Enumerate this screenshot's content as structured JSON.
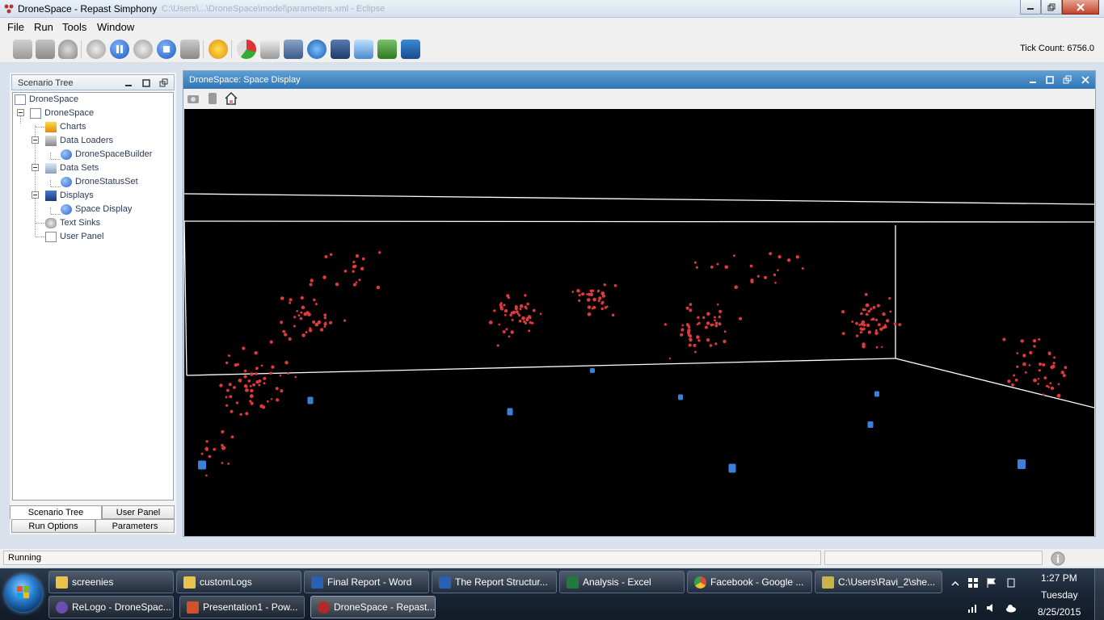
{
  "window": {
    "title": "DroneSpace - Repast Simphony",
    "ghost_title": "C:\\Users\\...\\DroneSpace\\model\\parameters.xml - Eclipse"
  },
  "menu": [
    "File",
    "Run",
    "Tools",
    "Window"
  ],
  "toolbar": {
    "tick_label": "Tick Count: 6756.0"
  },
  "scenario_tree": {
    "title": "Scenario Tree",
    "items": [
      "DroneSpace",
      "DroneSpace",
      "Charts",
      "Data Loaders",
      "DroneSpaceBuilder",
      "Data Sets",
      "DroneStatusSet",
      "Displays",
      "Space Display",
      "Text Sinks",
      "User Panel"
    ]
  },
  "bottom_tabs": {
    "scenario_tree": "Scenario Tree",
    "user_panel": "User Panel",
    "run_options": "Run Options",
    "parameters": "Parameters"
  },
  "display": {
    "title": "DroneSpace: Space Display"
  },
  "status": {
    "text": "Running"
  },
  "taskbar": {
    "row1": [
      {
        "label": "screenies",
        "color": "#e8c24a"
      },
      {
        "label": "customLogs",
        "color": "#e8c24a"
      },
      {
        "label": "Final Report - Word",
        "color": "#2b5fb4"
      },
      {
        "label": "The Report Structur...",
        "color": "#2b5fb4"
      },
      {
        "label": "Analysis - Excel",
        "color": "#1f7a3c"
      },
      {
        "label": "Facebook - Google ...",
        "color": "#d94b3a"
      },
      {
        "label": "C:\\Users\\Ravi_2\\she...",
        "color": "#c9b248"
      }
    ],
    "row2": [
      {
        "label": "ReLogo - DroneSpac...",
        "color": "#6a4fb0"
      },
      {
        "label": "Presentation1 - Pow...",
        "color": "#d0512b"
      },
      {
        "label": "DroneSpace - Repast...",
        "color": "#b02a2a"
      }
    ],
    "clock": {
      "time": "1:27 PM",
      "day": "Tuesday",
      "date": "8/25/2015"
    }
  },
  "colors": {
    "drone": "#3a7fd8",
    "particle": "#e0393b",
    "header": "#2f74b4"
  }
}
